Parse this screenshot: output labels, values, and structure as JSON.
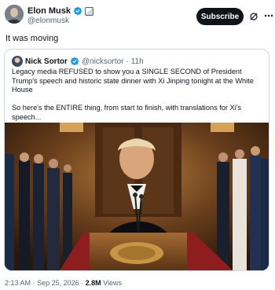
{
  "author": {
    "display_name": "Elon Musk",
    "handle": "@elonmusk",
    "avatar_icon": "profile-photo",
    "verified_icon": "verified-badge-icon",
    "badge_icon": "affiliation-square-badge"
  },
  "actions": {
    "subscribe_label": "Subscribe",
    "grok_icon": "grok-icon",
    "more_icon": "more-options-icon"
  },
  "tweet": {
    "text": "It was moving"
  },
  "quote": {
    "display_name": "Nick Sortor",
    "handle": "@nicksortor",
    "separator": "·",
    "time": "11h",
    "paragraph_1": "Legacy media REFUSED to show you a SINGLE SECOND of President Trump's speech and historic state dinner with Xi Jinping tonight at the White House",
    "paragraph_2": "So here's the ENTIRE thing, from start to finish, with translations for Xi's speech...",
    "media": {
      "description_icon": "video-thumbnail"
    }
  },
  "meta": {
    "time": "2:13 AM",
    "separator_1": "·",
    "date": "Sep 25, 2026",
    "separator_2": "·",
    "views_count": "2.8M",
    "views_label": "Views"
  },
  "colors": {
    "text_primary": "#0f1419",
    "text_secondary": "#536471",
    "verified_blue": "#1d9bf0",
    "border": "#cfd9de"
  }
}
